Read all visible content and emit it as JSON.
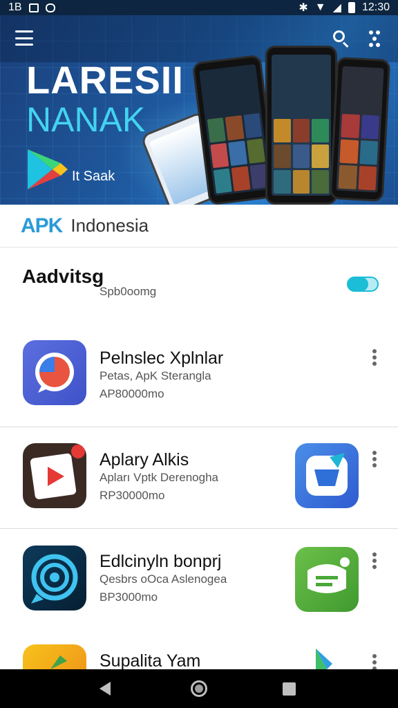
{
  "status_bar": {
    "left_text": "1B",
    "time": "12:30",
    "icons": [
      "image-icon",
      "shield-icon",
      "bluetooth-icon",
      "wifi-icon",
      "signal-icon",
      "battery-icon"
    ]
  },
  "hero": {
    "title": "LARESII",
    "subtitle": "NANAK",
    "caption": "It Saak",
    "icons": [
      "menu-icon",
      "search-icon",
      "more-icon",
      "play-store-logo"
    ]
  },
  "section": {
    "brand": "APK",
    "country": "Indonesia"
  },
  "setting": {
    "title": "Aadvitsg",
    "subtitle": "Spb0oomg",
    "toggle_on": true,
    "accent": "#1cbdd6"
  },
  "apps": [
    {
      "name": "Pelnslec Xplnlar",
      "desc": "Petas, ApK Sterangla",
      "price": "AP80000mo",
      "icon": "chat-bubble-icon",
      "side_icon": null
    },
    {
      "name": "Aplary Alkis",
      "desc": "Apları Vptk Derenogha",
      "price": "RP30000mo",
      "icon": "video-play-icon",
      "side_icon": "feather-badge-icon"
    },
    {
      "name": "Edlcinyln bonprj",
      "desc": "Qesbrs oOca Aslenogea",
      "price": "BP3000mo",
      "icon": "swirl-chat-icon",
      "side_icon": "green-chat-icon"
    },
    {
      "name": "Supalita Yam",
      "desc": "",
      "price": "",
      "icon": "yellow-app-icon",
      "side_icon": "play-triangle-icon"
    }
  ],
  "colors": {
    "brand_blue": "#2a9bd8",
    "hero_cyan": "#43d3f0"
  }
}
